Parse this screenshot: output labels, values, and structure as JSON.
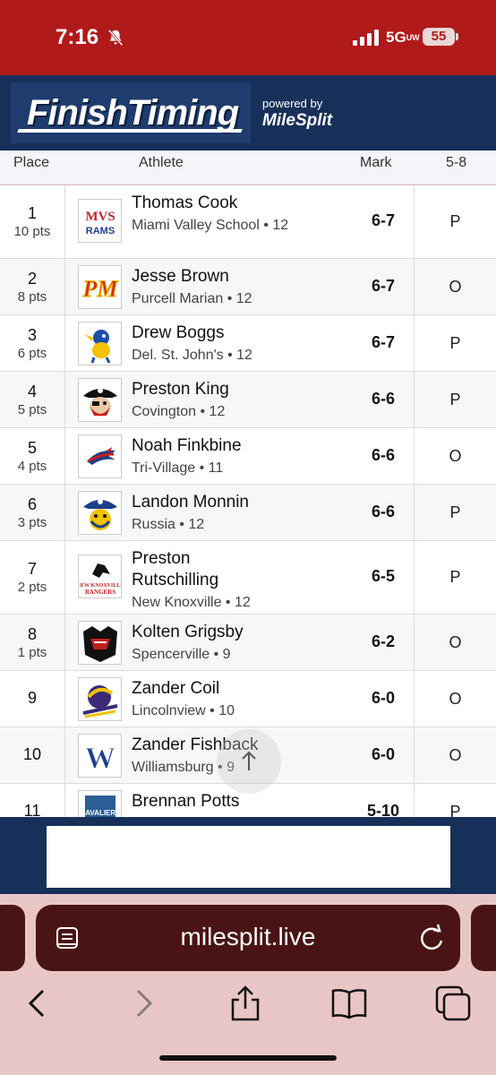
{
  "status": {
    "time": "7:16",
    "network": "5G",
    "network_sub": "UW",
    "battery": "55"
  },
  "header": {
    "logo_text": "FinishTiming",
    "powered_by": "powered by",
    "brand": "MileSplit"
  },
  "columns": {
    "place": "Place",
    "athlete": "Athlete",
    "mark": "Mark",
    "height": "5-8"
  },
  "rows": [
    {
      "place": "1",
      "pts": "10 pts",
      "name": "Thomas Cook",
      "school": "Miami Valley School • 12",
      "mark": "6-7",
      "result": "P",
      "logo": "MVS RAMS"
    },
    {
      "place": "2",
      "pts": "8 pts",
      "name": "Jesse Brown",
      "school": "Purcell Marian • 12",
      "mark": "6-7",
      "result": "O",
      "logo": "PM"
    },
    {
      "place": "3",
      "pts": "6 pts",
      "name": "Drew Boggs",
      "school": "Del. St. John's • 12",
      "mark": "6-7",
      "result": "P",
      "logo": "bird"
    },
    {
      "place": "4",
      "pts": "5 pts",
      "name": "Preston King",
      "school": "Covington • 12",
      "mark": "6-6",
      "result": "P",
      "logo": "pirate"
    },
    {
      "place": "5",
      "pts": "4 pts",
      "name": "Noah Finkbine",
      "school": "Tri-Village • 11",
      "mark": "6-6",
      "result": "O",
      "logo": "patriot"
    },
    {
      "place": "6",
      "pts": "3 pts",
      "name": "Landon Monnin",
      "school": "Russia • 12",
      "mark": "6-6",
      "result": "P",
      "logo": "raider"
    },
    {
      "place": "7",
      "pts": "2 pts",
      "name": "Preston Rutschilling",
      "school": "New Knoxville • 12",
      "mark": "6-5",
      "result": "P",
      "logo": "NEW KNOXVILLE RANGERS"
    },
    {
      "place": "8",
      "pts": "1 pts",
      "name": "Kolten Grigsby",
      "school": "Spencerville • 9",
      "mark": "6-2",
      "result": "O",
      "logo": "bearcat"
    },
    {
      "place": "9",
      "pts": "",
      "name": "Zander Coil",
      "school": "Lincolnview • 10",
      "mark": "6-0",
      "result": "O",
      "logo": "lancer"
    },
    {
      "place": "10",
      "pts": "",
      "name": "Zander Fishback",
      "school": "Williamsburg • 9",
      "mark": "6-0",
      "result": "O",
      "logo": "W"
    },
    {
      "place": "11",
      "pts": "",
      "name": "Brennan Potts",
      "school": "",
      "mark": "5-10",
      "result": "P",
      "logo": "CAVALIERS"
    }
  ],
  "browser": {
    "url": "milesplit.live"
  },
  "colors": {
    "status_red": "#b01a1a",
    "navy": "#17305a",
    "browser_pink": "#e9c6c6",
    "urlbar": "#4a1414"
  }
}
